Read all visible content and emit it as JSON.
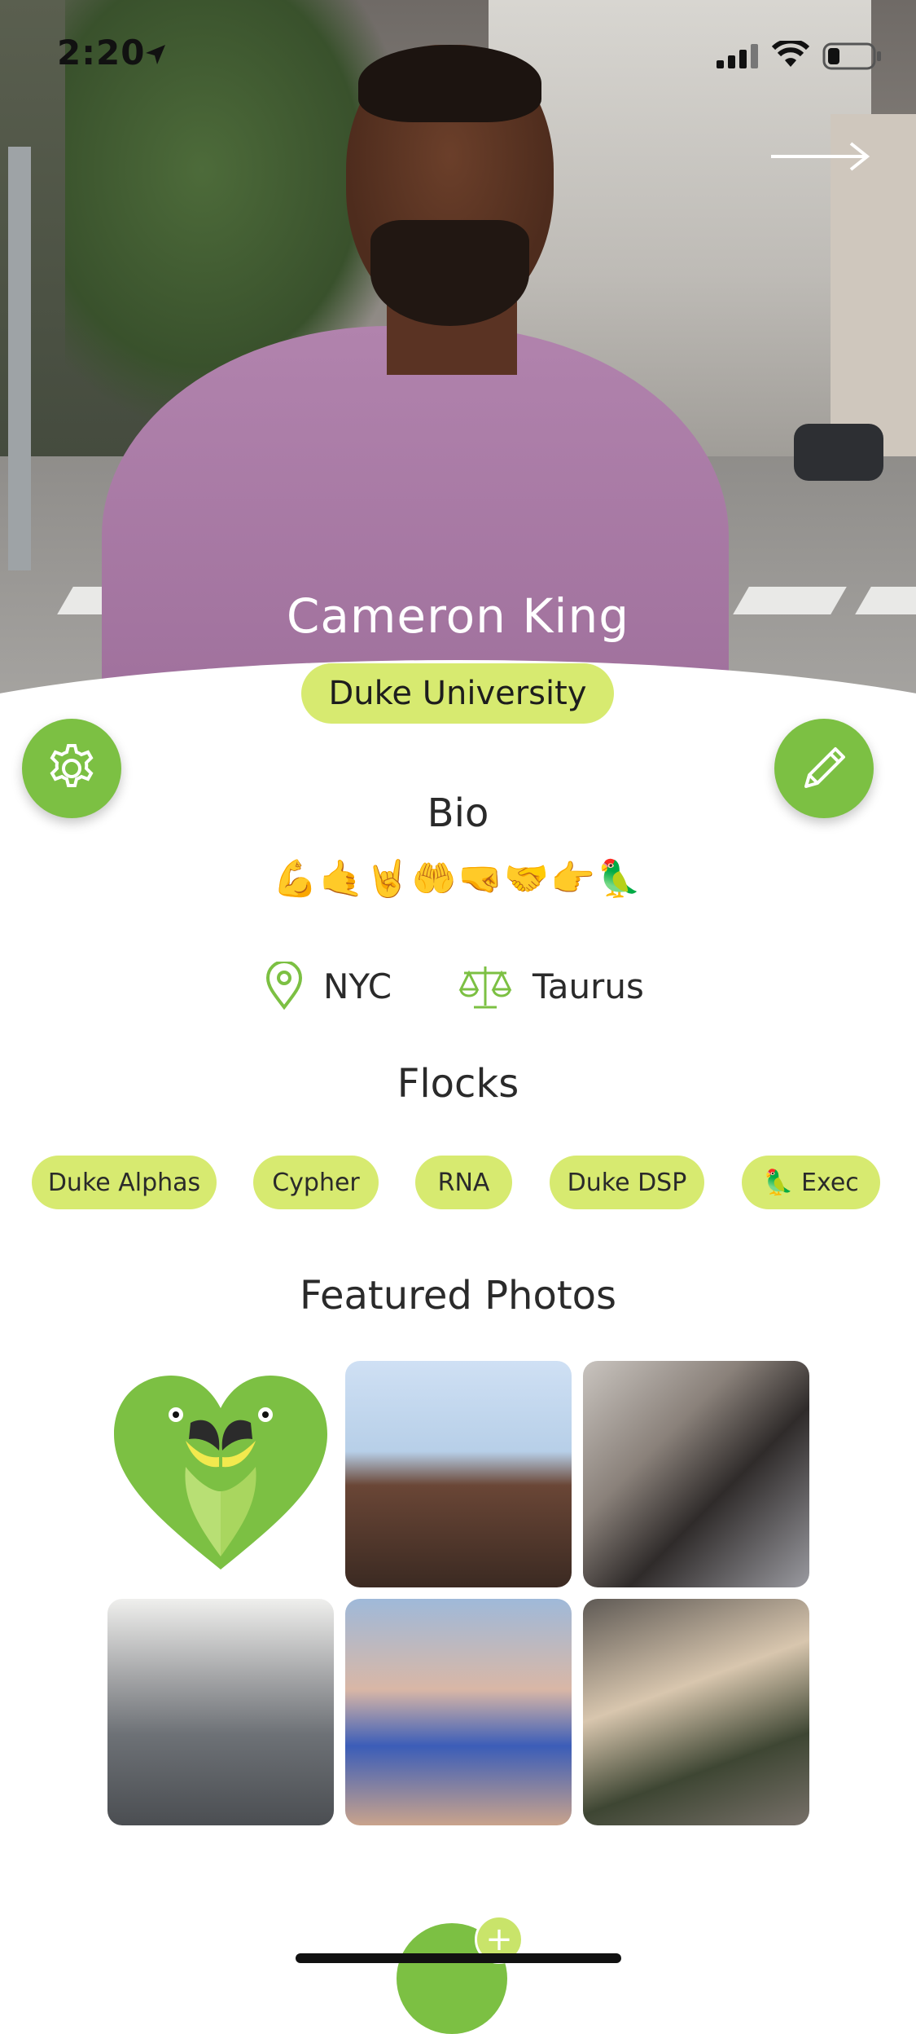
{
  "status_bar": {
    "time": "2:20"
  },
  "profile": {
    "name": "Cameron King",
    "school": "Duke University"
  },
  "bio": {
    "title": "Bio",
    "emojis": "💪🤙🤘🤲🤜🤝👉🦜"
  },
  "details": {
    "location": "NYC",
    "zodiac": "Taurus"
  },
  "flocks": {
    "title": "Flocks",
    "items": [
      {
        "label": "Duke Alphas"
      },
      {
        "label": "Cypher"
      },
      {
        "label": "RNA"
      },
      {
        "label": "Duke DSP"
      },
      {
        "label": "🦜 Exec"
      }
    ]
  },
  "featured": {
    "title": "Featured Photos",
    "photos": [
      {
        "name": "parrot-heart-logo"
      },
      {
        "name": "selfie-with-friend"
      },
      {
        "name": "friends-photo"
      },
      {
        "name": "vimeo-shirt-photo"
      },
      {
        "name": "beach-photo"
      },
      {
        "name": "hoodie-photo"
      }
    ]
  },
  "colors": {
    "accent_green": "#7cc043",
    "chip_lime": "#d7ea70"
  }
}
